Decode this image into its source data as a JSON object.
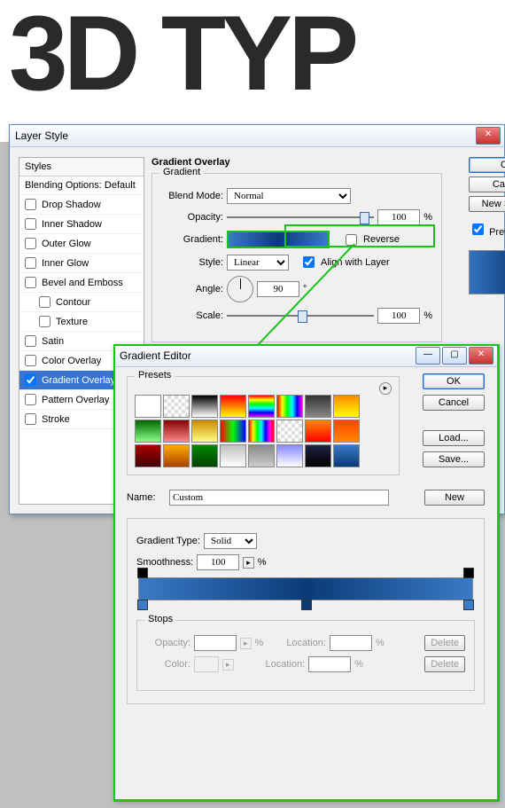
{
  "bg_text": "3D TYP",
  "layer": {
    "title": "Layer Style",
    "styles_header": "Styles",
    "blending": "Blending Options: Default",
    "items": [
      {
        "label": "Drop Shadow",
        "checked": false
      },
      {
        "label": "Inner Shadow",
        "checked": false
      },
      {
        "label": "Outer Glow",
        "checked": false
      },
      {
        "label": "Inner Glow",
        "checked": false
      },
      {
        "label": "Bevel and Emboss",
        "checked": false
      },
      {
        "label": "Contour",
        "checked": false,
        "indent": true
      },
      {
        "label": "Texture",
        "checked": false,
        "indent": true
      },
      {
        "label": "Satin",
        "checked": false
      },
      {
        "label": "Color Overlay",
        "checked": false
      },
      {
        "label": "Gradient Overlay",
        "checked": true,
        "selected": true
      },
      {
        "label": "Pattern Overlay",
        "checked": false
      },
      {
        "label": "Stroke",
        "checked": false
      }
    ],
    "panel_title": "Gradient Overlay",
    "group_title": "Gradient",
    "blend_mode_label": "Blend Mode:",
    "blend_mode": "Normal",
    "opacity_label": "Opacity:",
    "opacity": "100",
    "pct": "%",
    "gradient_label": "Gradient:",
    "reverse_label": "Reverse",
    "style_label": "Style:",
    "style_value": "Linear",
    "align_label": "Align with Layer",
    "angle_label": "Angle:",
    "angle": "90",
    "deg": "°",
    "scale_label": "Scale:",
    "scale": "100",
    "buttons": [
      "OK",
      "Cancel",
      "New Style..."
    ],
    "preview_label": "Preview"
  },
  "grad": {
    "title": "Gradient Editor",
    "presets_label": "Presets",
    "name_label": "Name:",
    "name_value": "Custom",
    "new_btn": "New",
    "type_label": "Gradient Type:",
    "type_value": "Solid",
    "smooth_label": "Smoothness:",
    "smooth_value": "100",
    "pct": "%",
    "stops_label": "Stops",
    "opacity_label": "Opacity:",
    "location_label": "Location:",
    "color_label": "Color:",
    "delete": "Delete",
    "buttons": [
      "OK",
      "Cancel",
      "Load...",
      "Save..."
    ],
    "preset_colors": [
      "linear-gradient(#fff,#fff)",
      "repeating-conic-gradient(#ddd 0 25%,#fff 0 50%) 0/8px 8px",
      "linear-gradient(#000,#fff)",
      "linear-gradient(#f00,#ff0)",
      "linear-gradient(#f00,#ff0,#0f0,#0ff,#00f,#f0f)",
      "linear-gradient(90deg,#f00,#ff0,#0f0,#0ff,#00f,#f0f)",
      "linear-gradient(#333,#888)",
      "linear-gradient(#f80,#ff0)",
      "linear-gradient(#060,#8f8)",
      "linear-gradient(#800,#f88)",
      "linear-gradient(#c80,#ff8)",
      "linear-gradient(90deg,#f00,#0f0,#00f)",
      "linear-gradient(90deg,#f00,#ff0,#0f0,#0ff,#00f,#f0f,#f00)",
      "repeating-conic-gradient(#ddd 0 25%,#fff 0 50%) 0/8px 8px",
      "linear-gradient(#f80,#f00)",
      "linear-gradient(#f40,#f80)",
      "linear-gradient(#a00,#400)",
      "linear-gradient(#fa0,#a40)",
      "linear-gradient(#080,#040)",
      "linear-gradient(#c0c0c0,#fff)",
      "linear-gradient(#888,#ccc)",
      "linear-gradient(#88f,#fff)",
      "linear-gradient(#224,#000)",
      "linear-gradient(#3a7ac6,#0a3a78)"
    ]
  }
}
